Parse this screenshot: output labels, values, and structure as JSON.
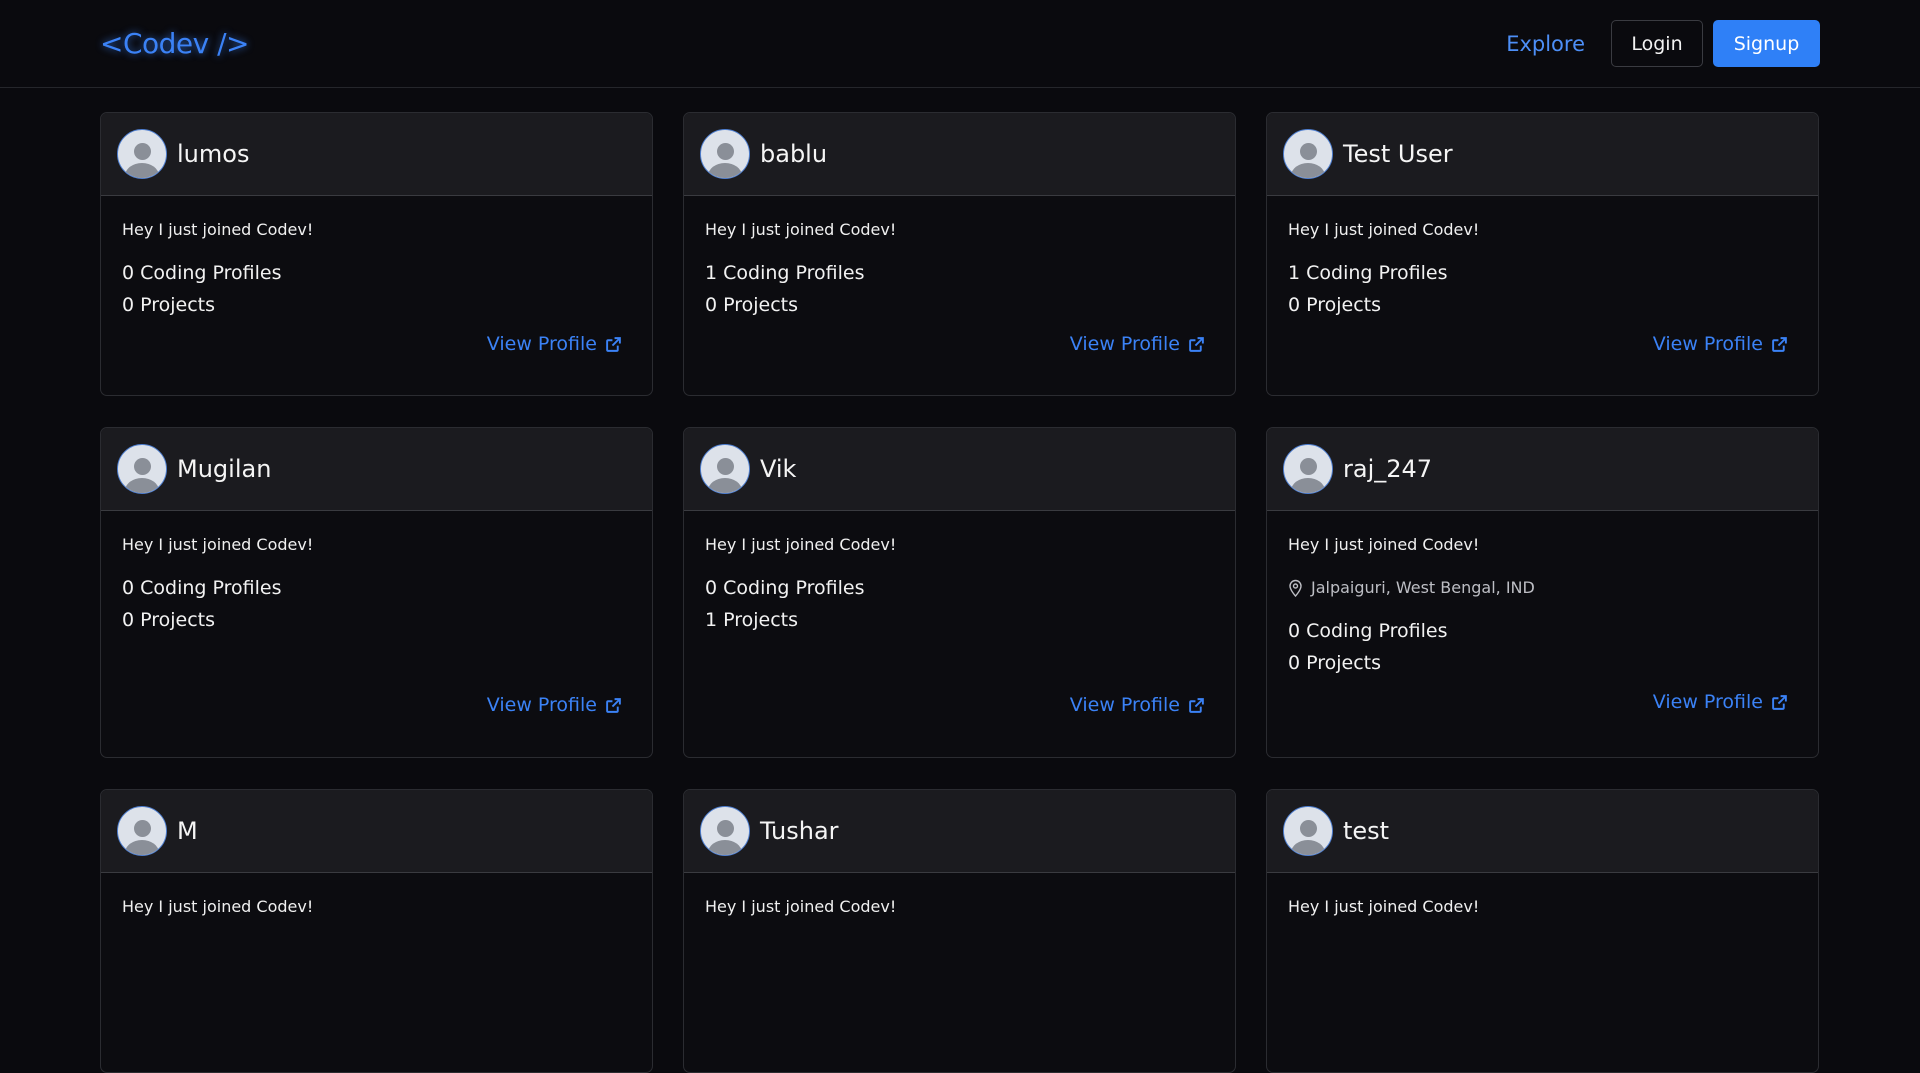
{
  "nav": {
    "logo": "<Codev />",
    "explore": "Explore",
    "login": "Login",
    "signup": "Signup"
  },
  "cards": [
    {
      "name": "lumos",
      "bio": "Hey I just joined Codev!",
      "location": "",
      "coding_profiles": "0 Coding Profiles",
      "projects": "0 Projects",
      "view": "View Profile"
    },
    {
      "name": "bablu",
      "bio": "Hey I just joined Codev!",
      "location": "",
      "coding_profiles": "1 Coding Profiles",
      "projects": "0 Projects",
      "view": "View Profile"
    },
    {
      "name": "Test User",
      "bio": "Hey I just joined Codev!",
      "location": "",
      "coding_profiles": "1 Coding Profiles",
      "projects": "0 Projects",
      "view": "View Profile"
    },
    {
      "name": "Mugilan",
      "bio": "Hey I just joined Codev!",
      "location": "",
      "coding_profiles": "0 Coding Profiles",
      "projects": "0 Projects",
      "view": "View Profile"
    },
    {
      "name": "Vik",
      "bio": "Hey I just joined Codev!",
      "location": "",
      "coding_profiles": "0 Coding Profiles",
      "projects": "1 Projects",
      "view": "View Profile"
    },
    {
      "name": "raj_247",
      "bio": "Hey I just joined Codev!",
      "location": "Jalpaiguri, West Bengal, IND",
      "coding_profiles": "0 Coding Profiles",
      "projects": "0 Projects",
      "view": "View Profile"
    },
    {
      "name": "M",
      "bio": "Hey I just joined Codev!",
      "location": "",
      "coding_profiles": "",
      "projects": "",
      "view": ""
    },
    {
      "name": "Tushar",
      "bio": "Hey I just joined Codev!",
      "location": "",
      "coding_profiles": "",
      "projects": "",
      "view": ""
    },
    {
      "name": "test",
      "bio": "Hey I just joined Codev!",
      "location": "",
      "coding_profiles": "",
      "projects": "",
      "view": ""
    }
  ],
  "icons": {
    "avatar": "user-avatar-icon",
    "location": "map-pin-icon",
    "external": "external-link-icon"
  },
  "colors": {
    "accent": "#3b82f6",
    "background": "#0a0a0e",
    "card_header": "#1b1b1f"
  }
}
